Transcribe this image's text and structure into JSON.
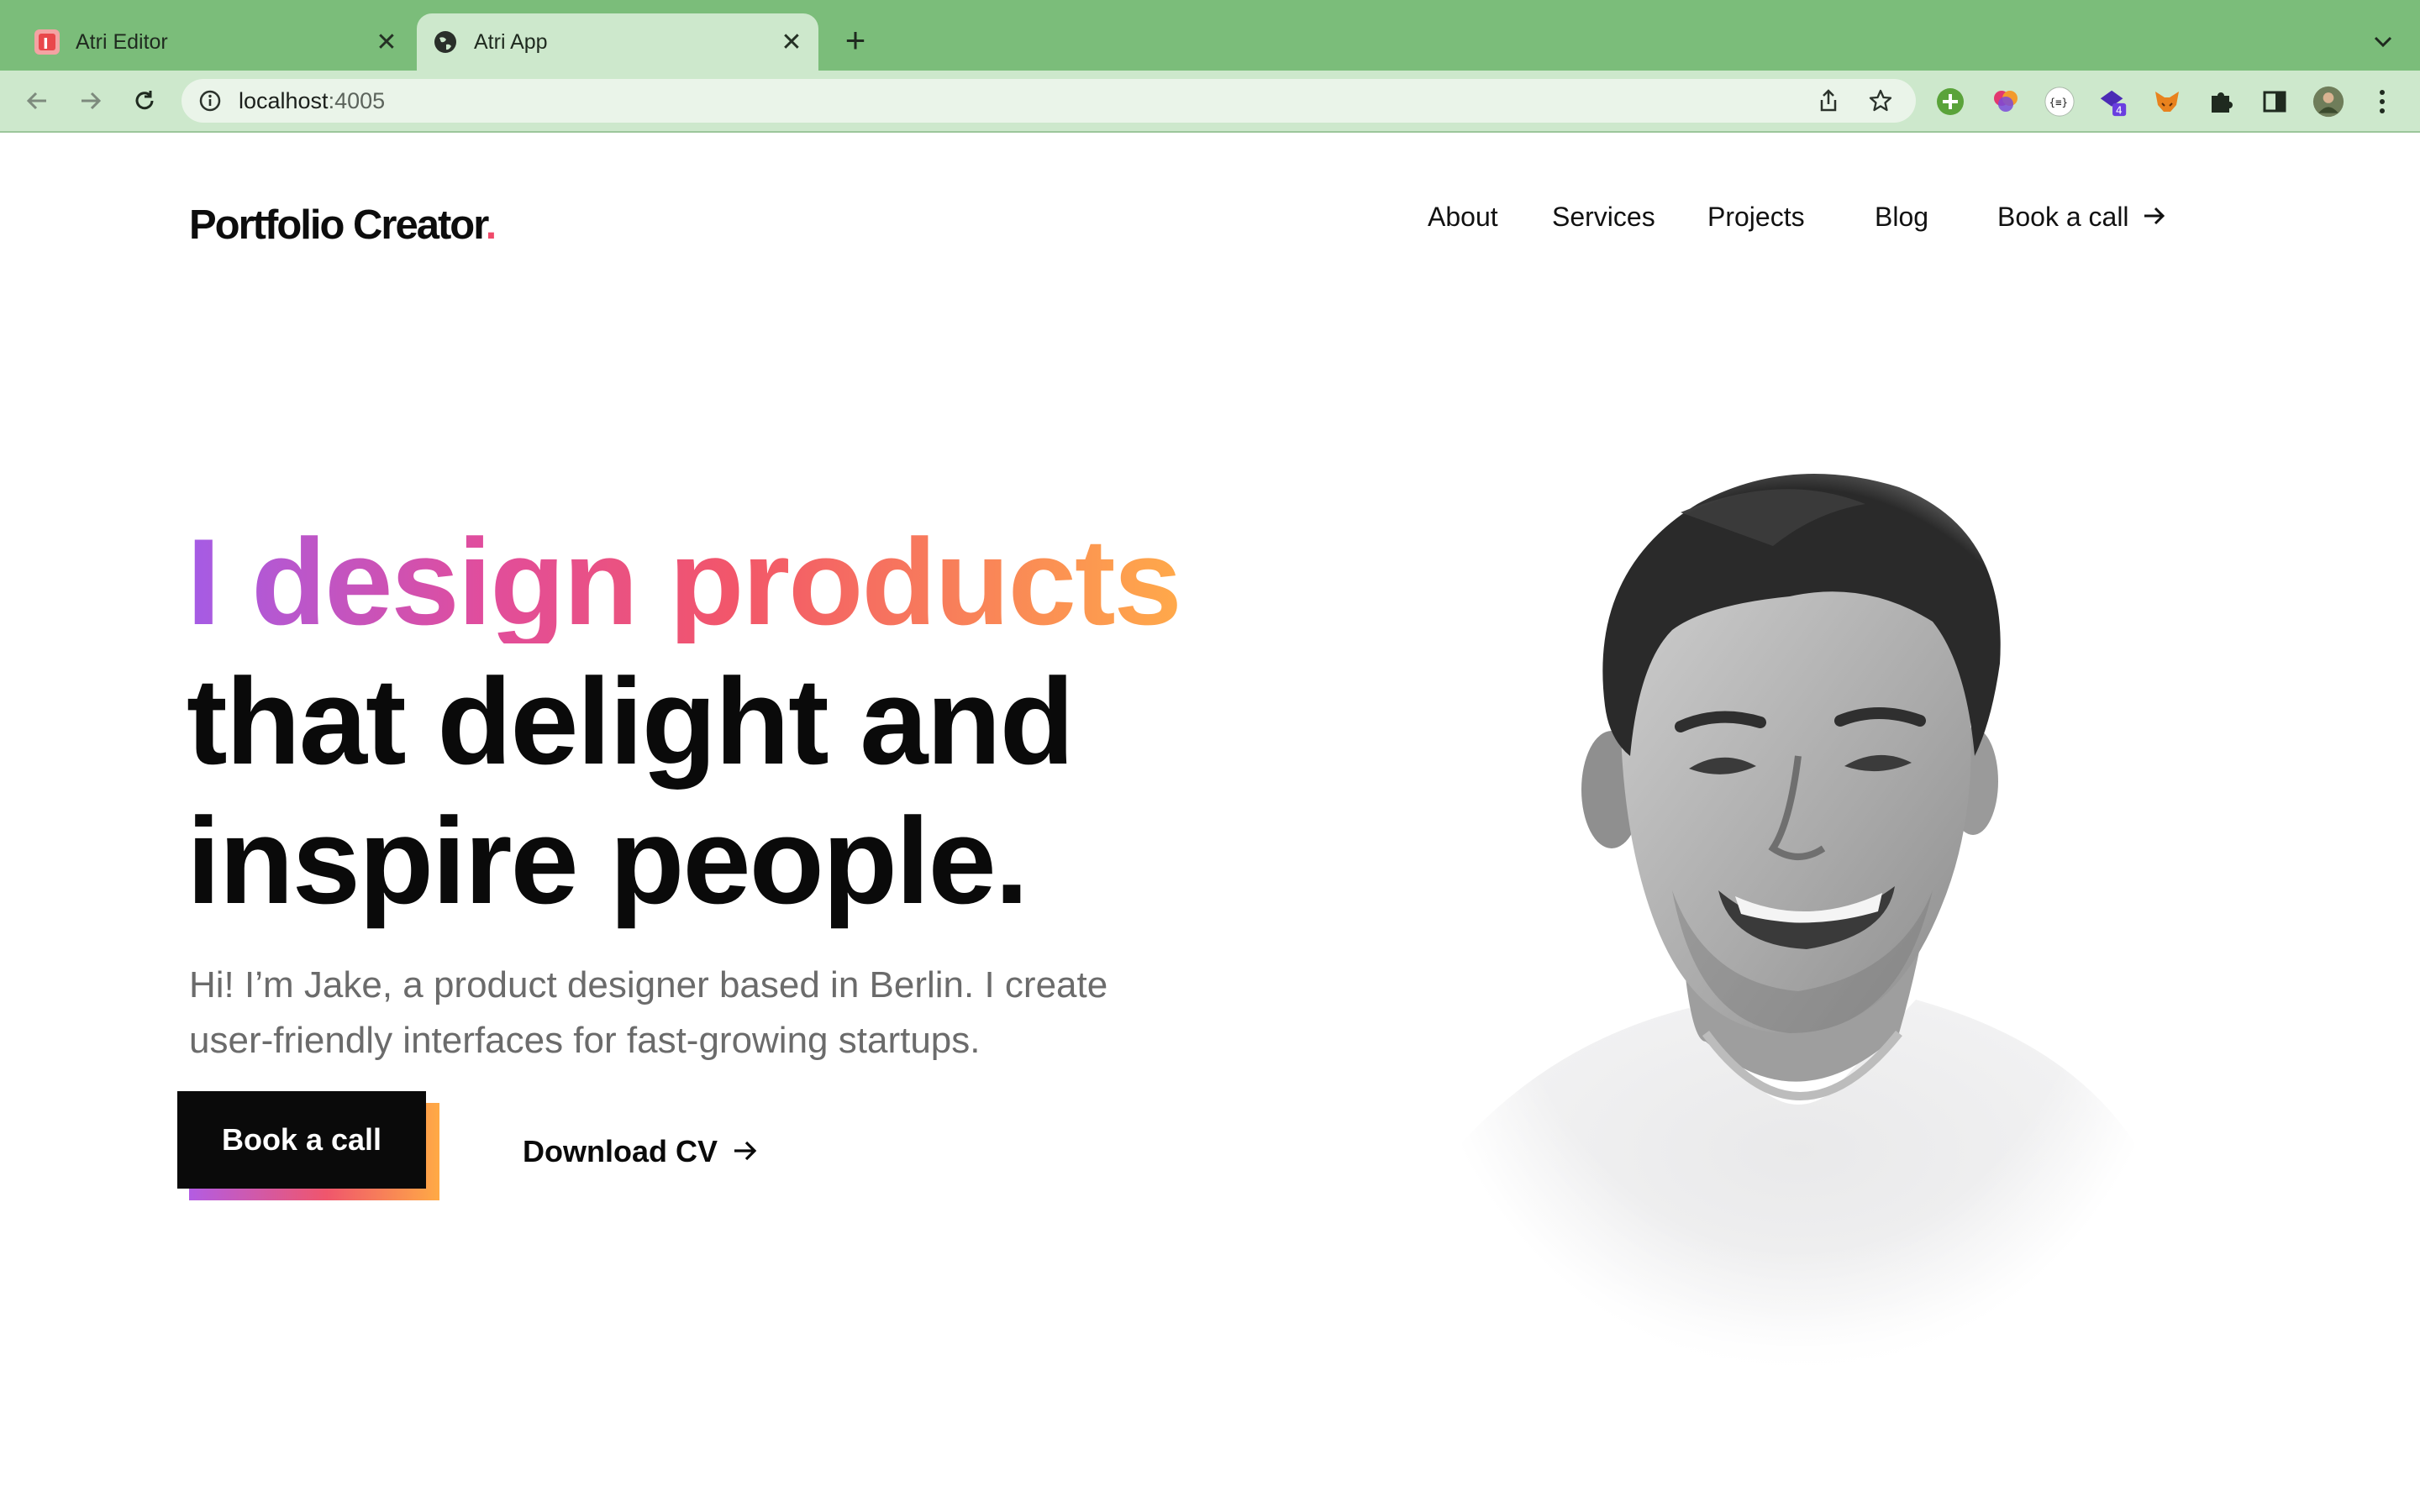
{
  "browser": {
    "tabs": [
      {
        "title": "Atri Editor",
        "active": false,
        "favicon": "atri-editor-icon"
      },
      {
        "title": "Atri App",
        "active": true,
        "favicon": "globe-icon"
      }
    ],
    "url": {
      "host": "localhost",
      "port": ":4005"
    },
    "extensions": [
      "green-plus-extension-icon",
      "palette-extension-icon",
      "json-extension-icon",
      "stack-extension-icon",
      "metamask-fox-icon",
      "puzzle-extensions-icon",
      "side-panel-icon",
      "profile-avatar"
    ],
    "extension_badge": "4",
    "colors": {
      "chrome": "#7bbd7a",
      "toolbar": "#cde8cc"
    }
  },
  "site": {
    "logo_text": "Portfolio Creator",
    "logo_dot": ".",
    "nav": [
      {
        "label": "About"
      },
      {
        "label": "Services"
      },
      {
        "label": "Projects"
      },
      {
        "label": "Blog"
      }
    ],
    "nav_cta": "Book a call",
    "hero": {
      "line1": "I design products",
      "line2": "that delight and",
      "line3": "inspire people.",
      "subtitle": "Hi! I’m Jake, a product designer based in Berlin. I create user-friendly interfaces for fast-growing startups.",
      "primary_cta": "Book a call",
      "secondary_cta": "Download CV"
    },
    "colors": {
      "gradient": [
        "#a45ce6",
        "#e14d9c",
        "#f2566a",
        "#ffa94a"
      ],
      "text": "#0a0a0a",
      "logo_dot": "#f04a6a"
    }
  }
}
